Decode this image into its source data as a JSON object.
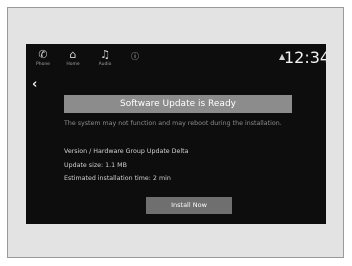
{
  "status_bar": {
    "items": [
      {
        "label": "Phone",
        "icon": "phone-icon"
      },
      {
        "label": "Home",
        "icon": "home-icon"
      },
      {
        "label": "Audio",
        "icon": "audio-icon"
      },
      {
        "label": "",
        "icon": "info-icon"
      }
    ],
    "signal_icon": "signal-icon",
    "clock": "12:34"
  },
  "dialog": {
    "back_icon": "back-icon",
    "title": "Software Update is Ready",
    "warning": "The system may not function and may reboot during the installation.",
    "version": "Version / Hardware Group Update Delta",
    "update_size": "Update size: 1.1 MB",
    "install_time": "Estimated installation time: 2 min",
    "install_button": "Install Now"
  },
  "colors": {
    "screen_bg": "#0d0d0d",
    "title_bg": "#8c8c8c",
    "button_bg": "#6f6f6f",
    "frame_bg": "#e3e3e3"
  }
}
